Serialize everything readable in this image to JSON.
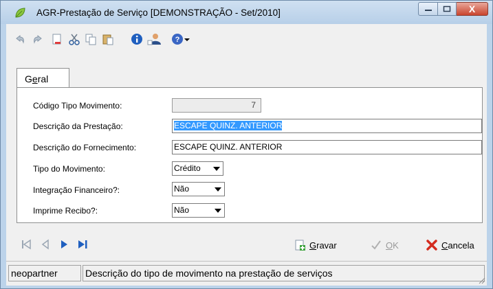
{
  "window": {
    "title": "AGR-Prestação de Serviço [DEMONSTRAÇÃO - Set/2010]",
    "close_glyph": "X"
  },
  "toolbar": {
    "icons": [
      "undo-icon",
      "redo-icon",
      "new-document-icon",
      "cut-icon",
      "copy-icon",
      "paste-icon",
      "info-icon",
      "user-icon",
      "help-icon",
      "dropdown-arrow-icon"
    ]
  },
  "tabs": [
    {
      "label": "Geral",
      "accel": "e"
    }
  ],
  "form": {
    "codigo": {
      "label": "Código Tipo Movimento:",
      "value": "7"
    },
    "descricao_prestacao": {
      "label": "Descrição da Prestação:",
      "value": "ESCAPE QUINZ. ANTERIOR"
    },
    "descricao_fornecimento": {
      "label": "Descrição do Fornecimento:",
      "value": "ESCAPE QUINZ. ANTERIOR"
    },
    "tipo_movimento": {
      "label": "Tipo do Movimento:",
      "value": "Crédito"
    },
    "integracao_financeiro": {
      "label": "Integração Financeiro?:",
      "value": "Não"
    },
    "imprime_recibo": {
      "label": "Imprime Recibo?:",
      "value": "Não"
    }
  },
  "actions": {
    "gravar": {
      "accel": "G",
      "rest": "ravar"
    },
    "ok": {
      "accel": "O",
      "rest": "K"
    },
    "cancela": {
      "accel": "C",
      "rest": "ancela"
    }
  },
  "status": {
    "user": "neopartner",
    "hint": "Descrição do tipo de movimento na prestação de serviços"
  },
  "colors": {
    "selection": "#3399ff",
    "accent_blue": "#1f5fbf",
    "cancel_red": "#d42b1e",
    "save_green": "#3da33d"
  }
}
